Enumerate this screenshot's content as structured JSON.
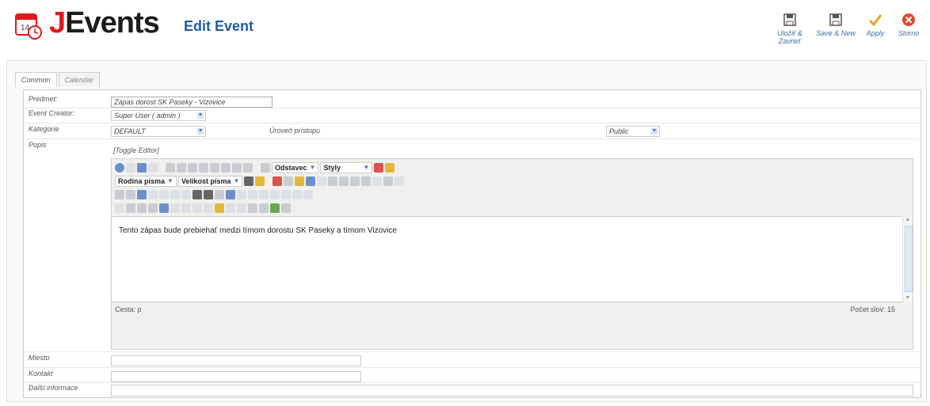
{
  "header": {
    "brand": "Events",
    "brand_initial": "J",
    "title": "Edit Event"
  },
  "toolbar": {
    "save_close": "Uložiť & Zavrieť",
    "save_new": "Save & New",
    "apply": "Apply",
    "cancel": "Storno"
  },
  "tabs": [
    {
      "label": "Common"
    },
    {
      "label": "Calendar"
    }
  ],
  "form": {
    "subject_label": "Predmet:",
    "subject_value": "Zápas dorost SK Paseky - Vizovice",
    "creator_label": "Event Creator:",
    "creator_value": "Super User ( admin )",
    "category_label": "Kategorie",
    "category_value": "DEFAULT",
    "access_label": "Úroveň prístupu",
    "access_value": "Public",
    "description_label": "Popis",
    "toggle_editor": "[Toggle Editor]",
    "location_label": "Miesto",
    "location_value": "",
    "contact_label": "Kontakt",
    "contact_value": "",
    "extra_label": "Další informace",
    "extra_value": ""
  },
  "editor": {
    "format_select": "Odstavec",
    "style_select": "Styly",
    "font_family_select": "Rodina písma",
    "font_size_select": "Velikost písma",
    "content": "Tento zápas bude prebiehať medzi tímom dorostu SK Paseky a tímom Vizovice",
    "path": "Cesta: p",
    "word_count": "Počet slov: 15"
  },
  "colors": {
    "brand_red": "#e01a1a",
    "title_blue": "#1f5e9e",
    "apply_orange": "#f0a020",
    "cancel_red": "#e0452a"
  }
}
